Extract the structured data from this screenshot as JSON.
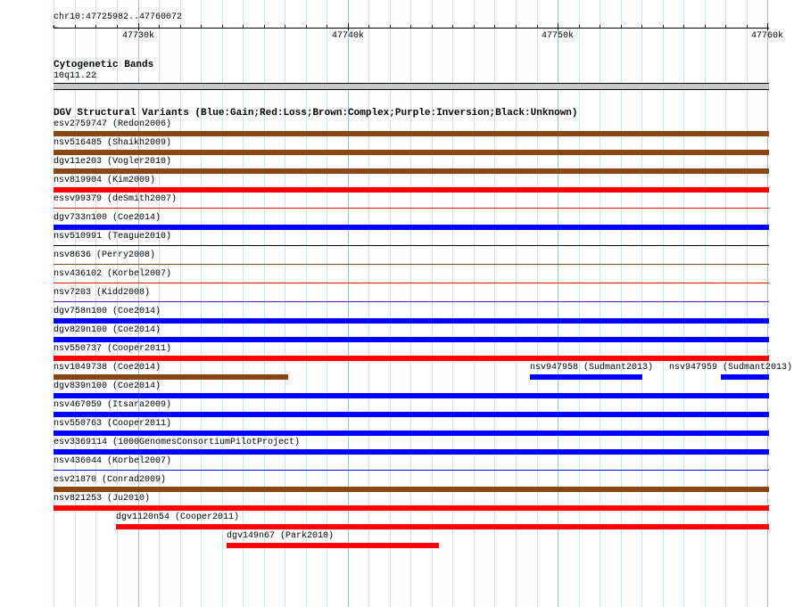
{
  "ruler": {
    "location": "chr10:47725982..47760072",
    "view_start": 47725982,
    "view_end": 47760072,
    "major_ticks": [
      {
        "pos": 47730000,
        "label": "47730k"
      },
      {
        "pos": 47740000,
        "label": "47740k"
      },
      {
        "pos": 47750000,
        "label": "47750k"
      },
      {
        "pos": 47760000,
        "label": "47760k"
      }
    ]
  },
  "cytoband": {
    "title": "Cytogenetic Bands",
    "band": "10q11.22"
  },
  "dgv": {
    "title": "DGV Structural Variants (Blue:Gain;Red:Loss;Brown:Complex;Purple:Inversion;Black:Unknown)",
    "colors": {
      "gain": "#0000ff",
      "loss": "#ff0000",
      "complex": "#8b4513",
      "inversion": "#6a0dad",
      "unknown": "#000000"
    },
    "rows": [
      [
        {
          "label": "esv2759747 (Redon2006)",
          "type": "complex",
          "style": "thick"
        }
      ],
      [
        {
          "label": "nsv516485 (Shaikh2009)",
          "type": "complex",
          "style": "thick"
        }
      ],
      [
        {
          "label": "dgv11e203 (Vogler2010)",
          "type": "complex",
          "style": "thick"
        }
      ],
      [
        {
          "label": "nsv819904 (Kim2009)",
          "type": "loss",
          "style": "thick"
        }
      ],
      [
        {
          "label": "essv99379 (deSmith2007)",
          "type": "loss",
          "style": "thin"
        }
      ],
      [
        {
          "label": "dgv733n100 (Coe2014)",
          "type": "gain",
          "style": "thick"
        }
      ],
      [
        {
          "label": "nsv510991 (Teague2010)",
          "type": "unknown",
          "style": "thin"
        }
      ],
      [
        {
          "label": "nsv8636 (Perry2008)",
          "type": "complex",
          "style": "thin"
        }
      ],
      [
        {
          "label": "nsv436102 (Korbel2007)",
          "type": "loss",
          "style": "thin"
        }
      ],
      [
        {
          "label": "nsv7203 (Kidd2008)",
          "type": "inversion",
          "style": "thin"
        }
      ],
      [
        {
          "label": "dgv758n100 (Coe2014)",
          "type": "gain",
          "style": "thick"
        }
      ],
      [
        {
          "label": "dgv829n100 (Coe2014)",
          "type": "gain",
          "style": "thick"
        }
      ],
      [
        {
          "label": "nsv550737 (Cooper2011)",
          "type": "loss",
          "style": "thick"
        }
      ],
      [
        {
          "label": "nsv1049738 (Coe2014)",
          "type": "complex",
          "style": "thick",
          "end": 47737170
        },
        {
          "label": "nsv947958 (Sudmant2013)",
          "type": "gain",
          "style": "thick",
          "start": 47748700,
          "end": 47754030
        },
        {
          "label": "nsv947959 (Sudmant2013)",
          "type": "gain",
          "style": "thick",
          "start": 47757760
        }
      ],
      [
        {
          "label": "dgv839n100 (Coe2014)",
          "type": "gain",
          "style": "thick"
        }
      ],
      [
        {
          "label": "nsv467059 (Itsara2009)",
          "type": "gain",
          "style": "thick"
        }
      ],
      [
        {
          "label": "nsv550763 (Cooper2011)",
          "type": "gain",
          "style": "thick"
        }
      ],
      [
        {
          "label": "esv3369114 (1000GenomesConsortiumPilotProject)",
          "type": "gain",
          "style": "thick"
        }
      ],
      [
        {
          "label": "nsv436044 (Korbel2007)",
          "type": "gain",
          "style": "thin"
        }
      ],
      [
        {
          "label": "esv21870 (Conrad2009)",
          "type": "complex",
          "style": "thick"
        }
      ],
      [
        {
          "label": "nsv821253 (Ju2010)",
          "type": "loss",
          "style": "thick"
        }
      ],
      [
        {
          "label": "dgv1120n54 (Cooper2011)",
          "type": "loss",
          "style": "thick",
          "start": 47728950
        }
      ],
      [
        {
          "label": "dgv149n67 (Park2010)",
          "type": "loss",
          "style": "thick",
          "start": 47734245,
          "end": 47744330
        }
      ]
    ]
  }
}
